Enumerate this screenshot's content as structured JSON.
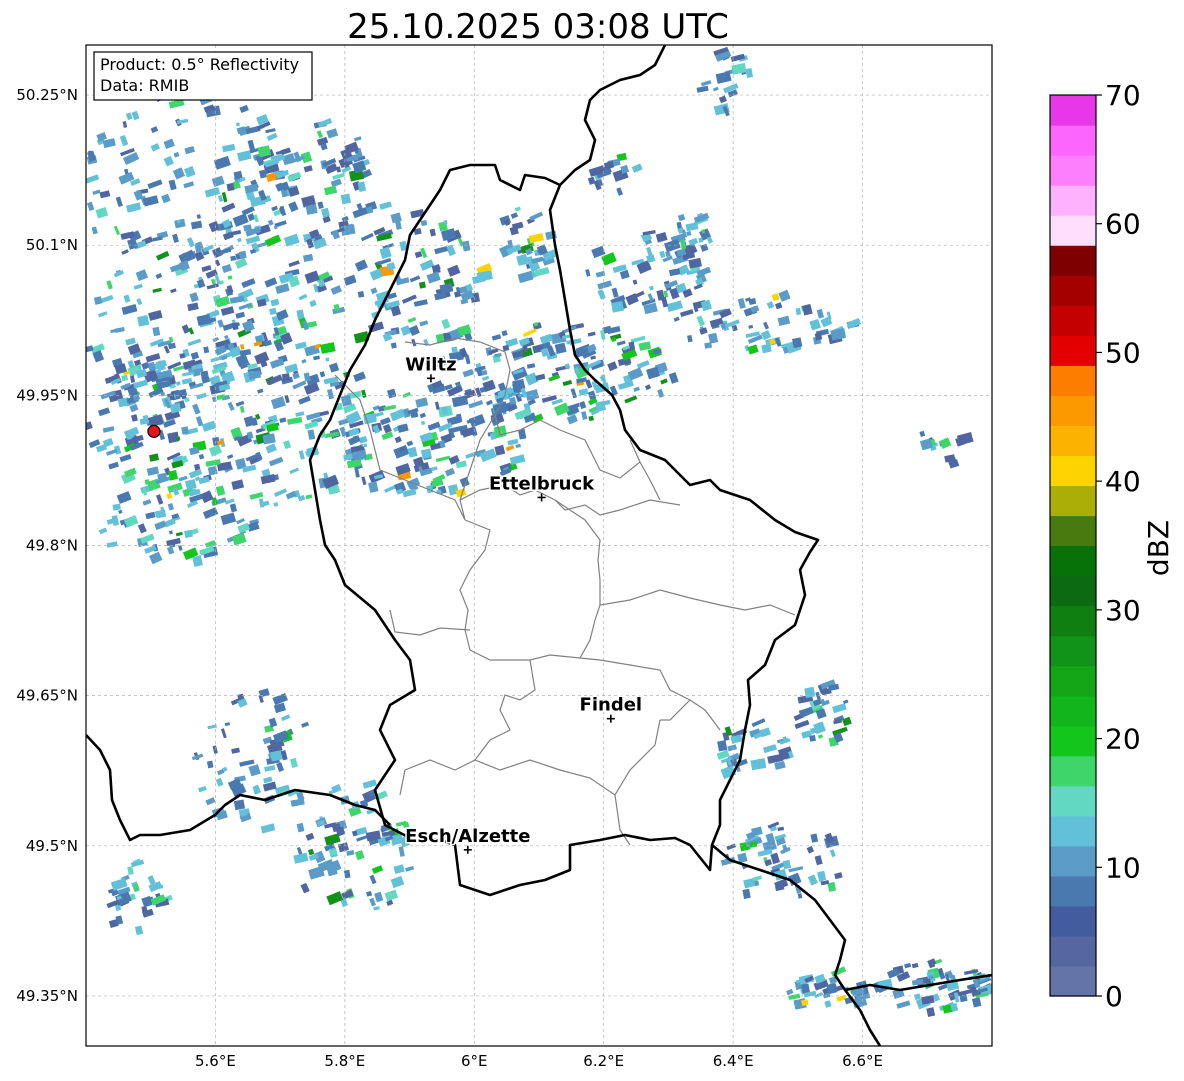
{
  "title": "25.10.2025 03:08 UTC",
  "info_box": {
    "product": "Product: 0.5° Reflectivity",
    "data": "Data: RMIB"
  },
  "map": {
    "lon_range": [
      5.4,
      6.8
    ],
    "lat_range": [
      49.3,
      50.3
    ],
    "x_ticks": [
      {
        "value": 5.6,
        "label": "5.6°E"
      },
      {
        "value": 5.8,
        "label": "5.8°E"
      },
      {
        "value": 6.0,
        "label": "6°E"
      },
      {
        "value": 6.2,
        "label": "6.2°E"
      },
      {
        "value": 6.4,
        "label": "6.4°E"
      },
      {
        "value": 6.6,
        "label": "6.6°E"
      }
    ],
    "y_ticks": [
      {
        "value": 50.25,
        "label": "50.25°N"
      },
      {
        "value": 50.1,
        "label": "50.1°N"
      },
      {
        "value": 49.95,
        "label": "49.95°N"
      },
      {
        "value": 49.8,
        "label": "49.8°N"
      },
      {
        "value": 49.65,
        "label": "49.65°N"
      },
      {
        "value": 49.5,
        "label": "49.5°N"
      },
      {
        "value": 49.35,
        "label": "49.35°N"
      }
    ],
    "grid": true,
    "cities": [
      {
        "name": "Wiltz",
        "lon": 5.933,
        "lat": 49.967
      },
      {
        "name": "Ettelbruck",
        "lon": 6.104,
        "lat": 49.848
      },
      {
        "name": "Findel",
        "lon": 6.211,
        "lat": 49.627
      },
      {
        "name": "Esch/Alzette",
        "lon": 5.99,
        "lat": 49.496
      }
    ],
    "radar_site": {
      "lon": 5.505,
      "lat": 49.914,
      "color": "#e8141b"
    }
  },
  "colorbar": {
    "label": "dBZ",
    "min": 0,
    "max": 70,
    "tick_labels": [
      "0",
      "10",
      "20",
      "30",
      "40",
      "50",
      "60",
      "70"
    ],
    "colors": [
      "#6474a8",
      "#5566a0",
      "#425c9e",
      "#4a79b0",
      "#5b9bc8",
      "#63c0d9",
      "#62d8c2",
      "#3ed66b",
      "#13c61b",
      "#12b51a",
      "#13a516",
      "#11931a",
      "#0f7f12",
      "#0b6a12",
      "#067208",
      "#487a10",
      "#abae06",
      "#fdd300",
      "#fcb300",
      "#fd9900",
      "#fd7d00",
      "#e30000",
      "#c40000",
      "#a50000",
      "#7f0000",
      "#fddffd",
      "#fdb2fd",
      "#fd7ffd",
      "#fc66fc",
      "#e837e8"
    ]
  },
  "echo_colors": [
    "#5066a0",
    "#4a79b0",
    "#5b9bc8",
    "#63c0d9",
    "#62d8c2",
    "#3ed66b",
    "#13c61b",
    "#11931a",
    "#fdd300",
    "#fd9900"
  ]
}
